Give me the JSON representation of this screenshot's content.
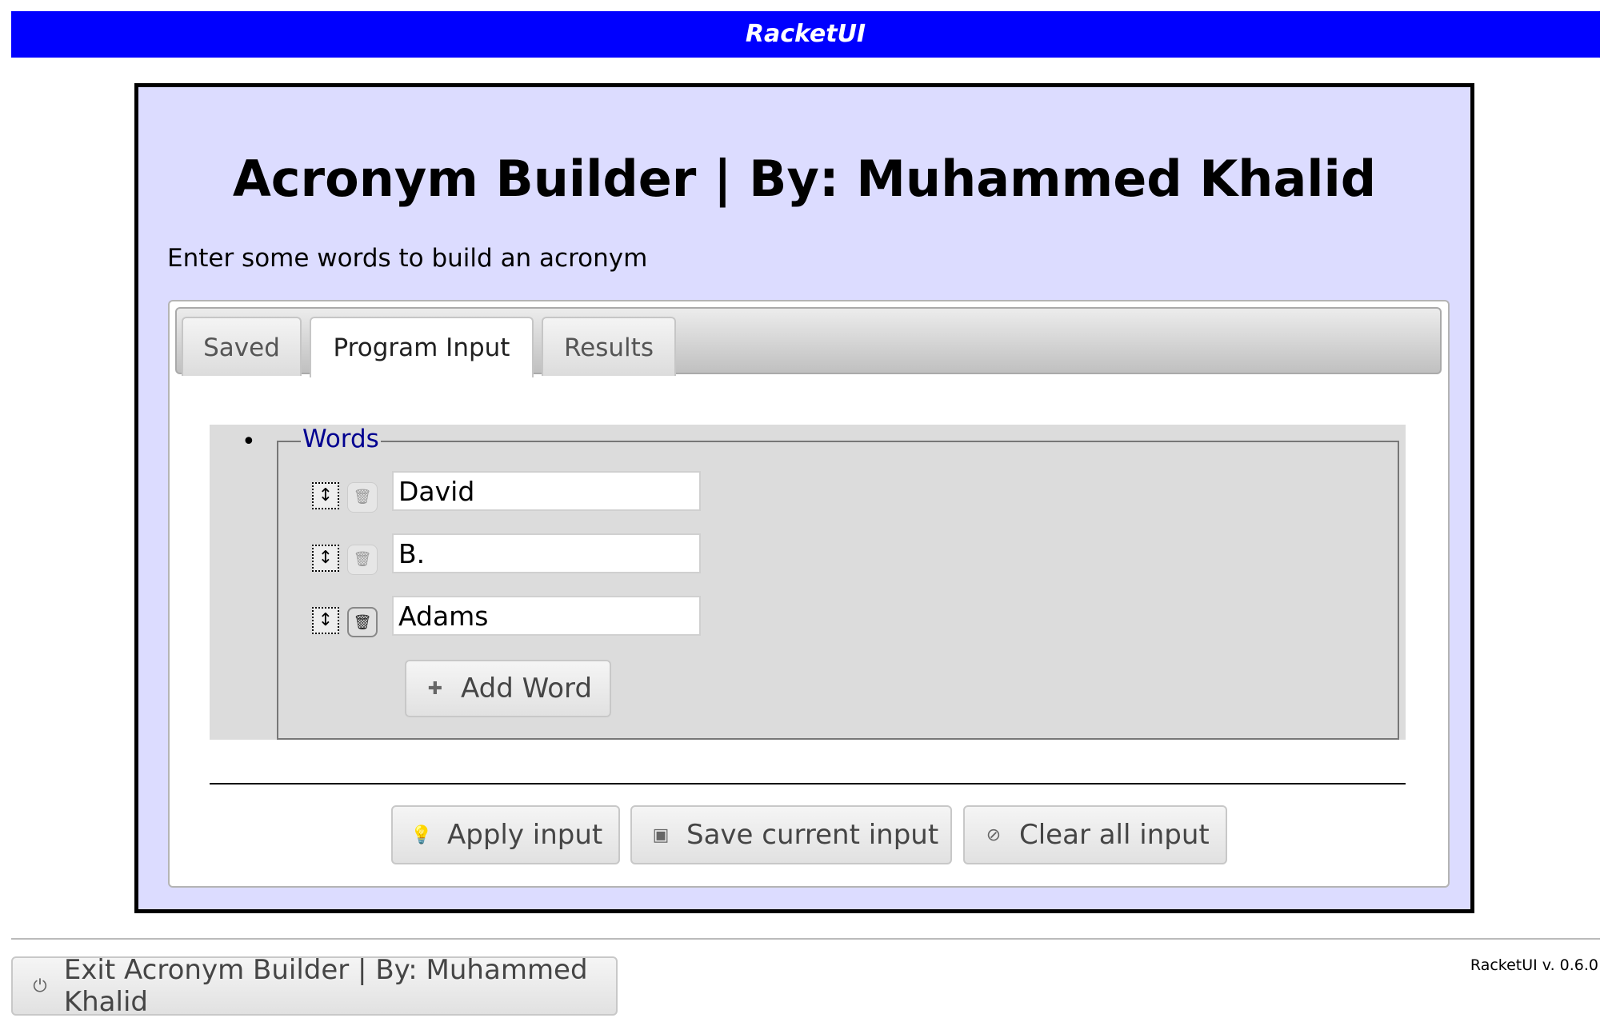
{
  "header": {
    "title": "RacketUI"
  },
  "app": {
    "title": "Acronym Builder | By: Muhammed Khalid",
    "description": "Enter some words to build an acronym"
  },
  "tabs": [
    {
      "label": "Saved",
      "active": false
    },
    {
      "label": "Program Input",
      "active": true
    },
    {
      "label": "Results",
      "active": false
    }
  ],
  "input": {
    "legend": "Words",
    "words": [
      "David",
      "B.",
      "Adams"
    ],
    "add_label": "Add Word"
  },
  "actions": {
    "apply": "Apply input",
    "save": "Save current input",
    "clear": "Clear all input"
  },
  "footer": {
    "exit": "Exit Acronym Builder | By: Muhammed Khalid",
    "version": "RacketUI v. 0.6.0"
  }
}
